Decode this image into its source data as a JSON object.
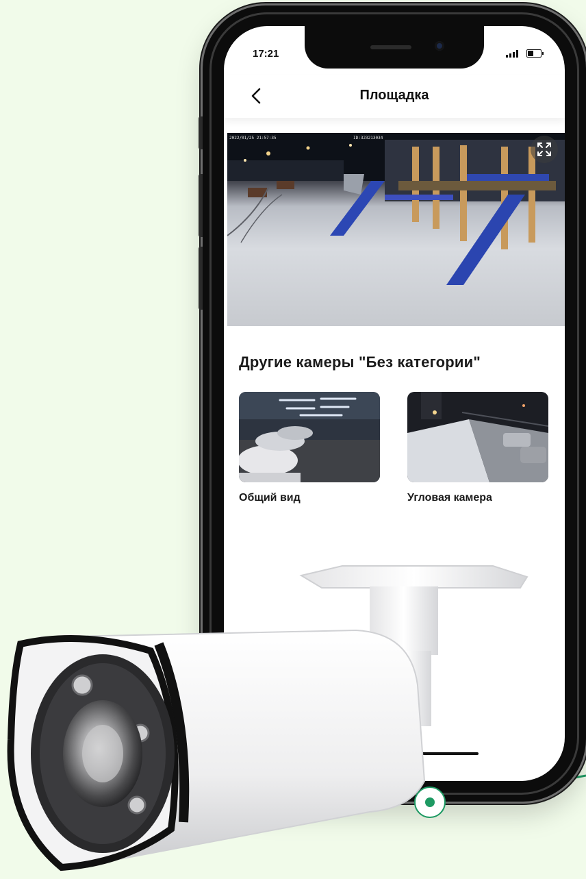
{
  "status_bar": {
    "time": "17:21"
  },
  "header": {
    "title": "Площадка",
    "back_icon": "chevron-left-icon"
  },
  "live_view": {
    "timestamp_overlay": "2022/01/25 21:57:35",
    "camera_overlay": "ID:323213034",
    "fullscreen_icon": "expand-icon"
  },
  "other_cameras": {
    "title": "Другие камеры \"Без категории\"",
    "items": [
      {
        "label": "Общий вид"
      },
      {
        "label": "Угловая камера"
      }
    ]
  },
  "colors": {
    "accent": "#1e9a63",
    "background": "#f1fbea"
  }
}
